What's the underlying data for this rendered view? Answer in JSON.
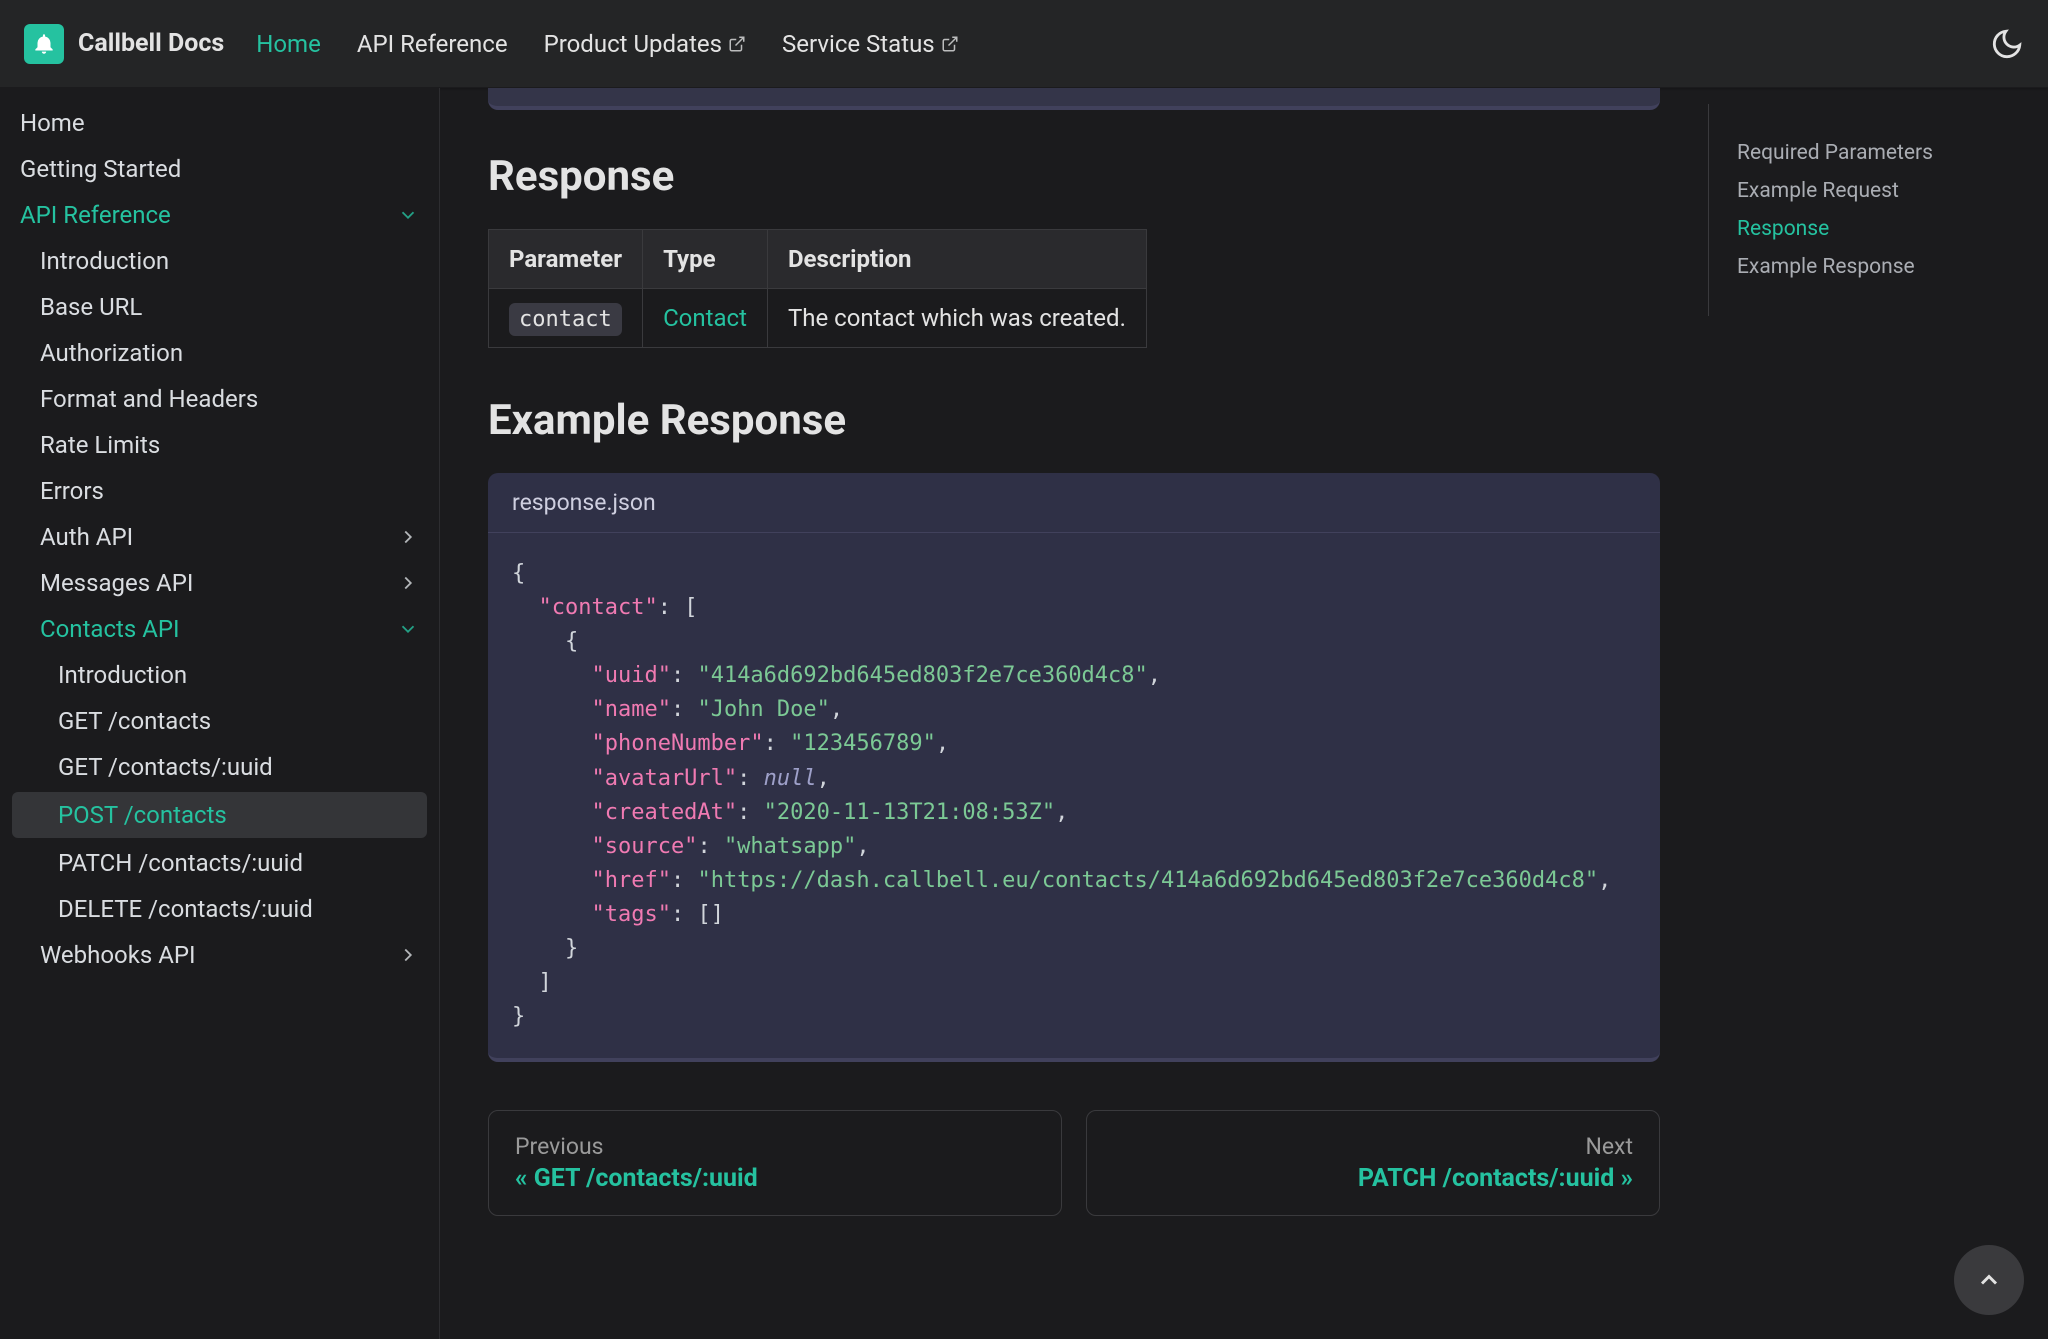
{
  "brand": "Callbell Docs",
  "nav": {
    "home": "Home",
    "api_ref": "API Reference",
    "product_updates": "Product Updates",
    "service_status": "Service Status"
  },
  "sidebar": {
    "home": "Home",
    "getting_started": "Getting Started",
    "api_reference": "API Reference",
    "introduction": "Introduction",
    "base_url": "Base URL",
    "authorization": "Authorization",
    "format_headers": "Format and Headers",
    "rate_limits": "Rate Limits",
    "errors": "Errors",
    "auth_api": "Auth API",
    "messages_api": "Messages API",
    "contacts_api": "Contacts API",
    "contacts_intro": "Introduction",
    "get_contacts": "GET /contacts",
    "get_contacts_uuid": "GET /contacts/:uuid",
    "post_contacts": "POST /contacts",
    "patch_contacts": "PATCH /contacts/:uuid",
    "delete_contacts": "DELETE /contacts/:uuid",
    "webhooks_api": "Webhooks API"
  },
  "content": {
    "response_heading": "Response",
    "table": {
      "h1": "Parameter",
      "h2": "Type",
      "h3": "Description",
      "param": "contact",
      "type": "Contact",
      "desc": "The contact which was created."
    },
    "example_response_heading": "Example Response",
    "code_title": "response.json",
    "json": {
      "l1": "{",
      "l2a": "  \"contact\"",
      "l2b": ": [",
      "l3": "    {",
      "l4k": "      \"uuid\"",
      "l4v": "\"414a6d692bd645ed803f2e7ce360d4c8\"",
      "l5k": "      \"name\"",
      "l5v": "\"John Doe\"",
      "l6k": "      \"phoneNumber\"",
      "l6v": "\"123456789\"",
      "l7k": "      \"avatarUrl\"",
      "l7v": "null",
      "l8k": "      \"createdAt\"",
      "l8v": "\"2020-11-13T21:08:53Z\"",
      "l9k": "      \"source\"",
      "l9v": "\"whatsapp\"",
      "l10k": "      \"href\"",
      "l10v": "\"https://dash.callbell.eu/contacts/414a6d692bd645ed803f2e7ce360d4c8\"",
      "l11k": "      \"tags\"",
      "l11v": ": []",
      "l12": "    }",
      "l13": "  ]",
      "l14": "}"
    },
    "prev_label": "Previous",
    "prev_title": "« GET /contacts/:uuid",
    "next_label": "Next",
    "next_title": "PATCH /contacts/:uuid »"
  },
  "toc": {
    "required_params": "Required Parameters",
    "example_request": "Example Request",
    "response": "Response",
    "example_response": "Example Response"
  }
}
